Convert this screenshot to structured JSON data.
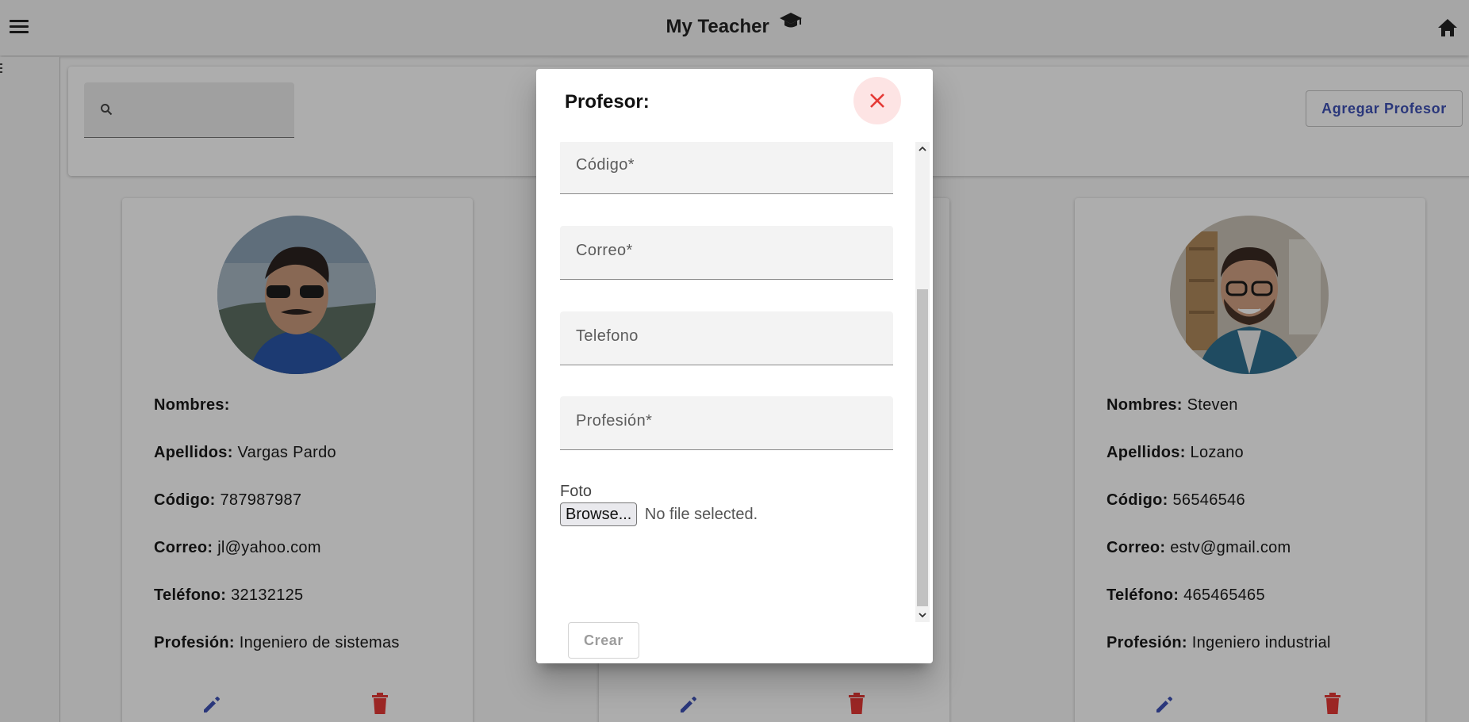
{
  "app": {
    "title": "My Teacher",
    "title_icon": "graduation-cap-icon",
    "menu_icon": "hamburger-menu-icon",
    "home_icon": "home-icon"
  },
  "search": {
    "icon": "search-icon",
    "placeholder": "",
    "value": ""
  },
  "add_button_label": "Agregar Profesor",
  "cards": [
    {
      "nombres_label": "Nombres:",
      "nombres": "",
      "apellidos_label": "Apellidos:",
      "apellidos": "Vargas Pardo",
      "codigo_label": "Código:",
      "codigo": "787987987",
      "correo_label": "Correo:",
      "correo": "jl@yahoo.com",
      "telefono_label": "Teléfono:",
      "telefono": "32132125",
      "profesion_label": "Profesión:",
      "profesion": "Ingeniero de sistemas"
    },
    {
      "nombres_label": "Nombres:",
      "nombres": "Steven",
      "apellidos_label": "Apellidos:",
      "apellidos": "Lozano",
      "codigo_label": "Código:",
      "codigo": "56546546",
      "correo_label": "Correo:",
      "correo": "estv@gmail.com",
      "telefono_label": "Teléfono:",
      "telefono": "465465465",
      "profesion_label": "Profesión:",
      "profesion": "Ingeniero industrial"
    }
  ],
  "dialog": {
    "title": "Profesor:",
    "close_icon": "close-icon",
    "fields": {
      "codigo": "Código*",
      "correo": "Correo*",
      "telefono": "Telefono",
      "profesion": "Profesión*"
    },
    "foto_label": "Foto",
    "browse_label": "Browse...",
    "file_status": "No file selected.",
    "submit_label": "Crear"
  },
  "colors": {
    "primary": "#3f51b5",
    "danger": "#e53935",
    "close_bg": "#fde4e4",
    "overlay": "rgba(0,0,0,0.32)"
  }
}
